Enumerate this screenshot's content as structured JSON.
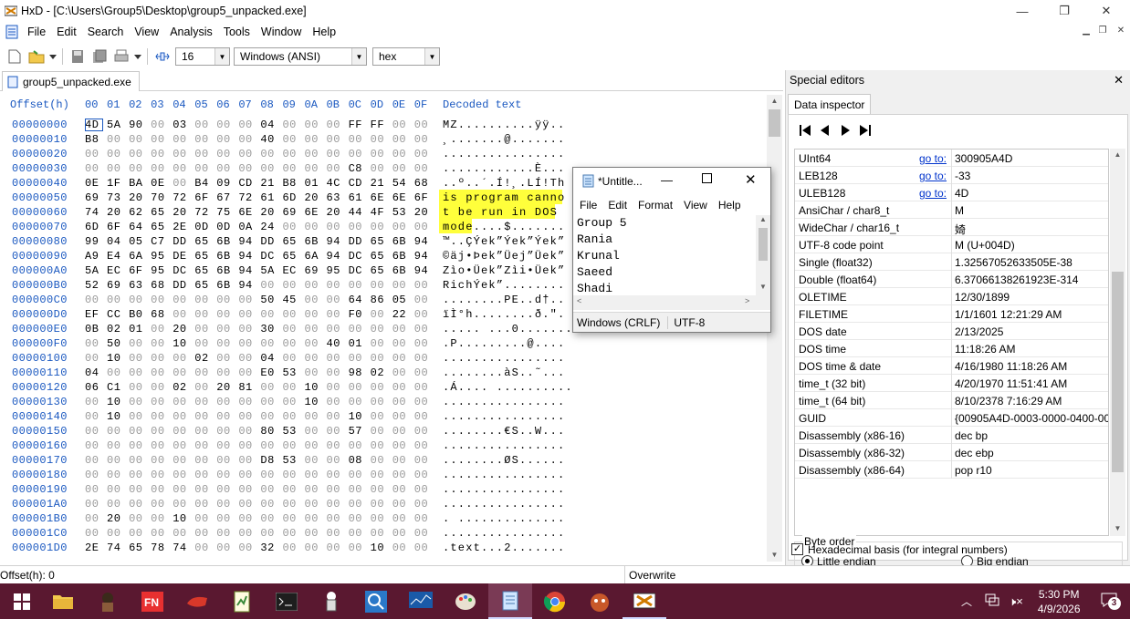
{
  "window": {
    "title": "HxD - [C:\\Users\\Group5\\Desktop\\group5_unpacked.exe]",
    "controls": {
      "minimize": "—",
      "maximize": "❐",
      "close": "✕"
    }
  },
  "menu": [
    "File",
    "Edit",
    "Search",
    "View",
    "Analysis",
    "Tools",
    "Window",
    "Help"
  ],
  "toolbar": {
    "bytes_per_row": "16",
    "charset": "Windows (ANSI)",
    "display_mode": "hex"
  },
  "tab": {
    "label": "group5_unpacked.exe"
  },
  "hex": {
    "offset_header": "Offset(h)",
    "column_headers": [
      "00",
      "01",
      "02",
      "03",
      "04",
      "05",
      "06",
      "07",
      "08",
      "09",
      "0A",
      "0B",
      "0C",
      "0D",
      "0E",
      "0F"
    ],
    "decoded_header": "Decoded text",
    "rows": [
      {
        "offset": "00000000",
        "bytes": [
          "4D",
          "5A",
          "90",
          "00",
          "03",
          "00",
          "00",
          "00",
          "04",
          "00",
          "00",
          "00",
          "FF",
          "FF",
          "00",
          "00"
        ],
        "decoded": "MZ..........ÿÿ.."
      },
      {
        "offset": "00000010",
        "bytes": [
          "B8",
          "00",
          "00",
          "00",
          "00",
          "00",
          "00",
          "00",
          "40",
          "00",
          "00",
          "00",
          "00",
          "00",
          "00",
          "00"
        ],
        "decoded": "¸.......@......."
      },
      {
        "offset": "00000020",
        "bytes": [
          "00",
          "00",
          "00",
          "00",
          "00",
          "00",
          "00",
          "00",
          "00",
          "00",
          "00",
          "00",
          "00",
          "00",
          "00",
          "00"
        ],
        "decoded": "................"
      },
      {
        "offset": "00000030",
        "bytes": [
          "00",
          "00",
          "00",
          "00",
          "00",
          "00",
          "00",
          "00",
          "00",
          "00",
          "00",
          "00",
          "C8",
          "00",
          "00",
          "00"
        ],
        "decoded": "............È..."
      },
      {
        "offset": "00000040",
        "bytes": [
          "0E",
          "1F",
          "BA",
          "0E",
          "00",
          "B4",
          "09",
          "CD",
          "21",
          "B8",
          "01",
          "4C",
          "CD",
          "21",
          "54",
          "68"
        ],
        "decoded": "..º..´.Í!¸.LÍ!Th"
      },
      {
        "offset": "00000050",
        "bytes": [
          "69",
          "73",
          "20",
          "70",
          "72",
          "6F",
          "67",
          "72",
          "61",
          "6D",
          "20",
          "63",
          "61",
          "6E",
          "6E",
          "6F"
        ],
        "decoded": "is program canno"
      },
      {
        "offset": "00000060",
        "bytes": [
          "74",
          "20",
          "62",
          "65",
          "20",
          "72",
          "75",
          "6E",
          "20",
          "69",
          "6E",
          "20",
          "44",
          "4F",
          "53",
          "20"
        ],
        "decoded": "t be run in DOS "
      },
      {
        "offset": "00000070",
        "bytes": [
          "6D",
          "6F",
          "64",
          "65",
          "2E",
          "0D",
          "0D",
          "0A",
          "24",
          "00",
          "00",
          "00",
          "00",
          "00",
          "00",
          "00"
        ],
        "decoded": "mode....$......."
      },
      {
        "offset": "00000080",
        "bytes": [
          "99",
          "04",
          "05",
          "C7",
          "DD",
          "65",
          "6B",
          "94",
          "DD",
          "65",
          "6B",
          "94",
          "DD",
          "65",
          "6B",
          "94"
        ],
        "decoded": "™..ÇÝek”Ýek”Ýek”"
      },
      {
        "offset": "00000090",
        "bytes": [
          "A9",
          "E4",
          "6A",
          "95",
          "DE",
          "65",
          "6B",
          "94",
          "DC",
          "65",
          "6A",
          "94",
          "DC",
          "65",
          "6B",
          "94"
        ],
        "decoded": "©äj•Þek”Üej”Üek”"
      },
      {
        "offset": "000000A0",
        "bytes": [
          "5A",
          "EC",
          "6F",
          "95",
          "DC",
          "65",
          "6B",
          "94",
          "5A",
          "EC",
          "69",
          "95",
          "DC",
          "65",
          "6B",
          "94"
        ],
        "decoded": "Zìo•Üek”Zìi•Üek”"
      },
      {
        "offset": "000000B0",
        "bytes": [
          "52",
          "69",
          "63",
          "68",
          "DD",
          "65",
          "6B",
          "94",
          "00",
          "00",
          "00",
          "00",
          "00",
          "00",
          "00",
          "00"
        ],
        "decoded": "RichÝek”........"
      },
      {
        "offset": "000000C0",
        "bytes": [
          "00",
          "00",
          "00",
          "00",
          "00",
          "00",
          "00",
          "00",
          "50",
          "45",
          "00",
          "00",
          "64",
          "86",
          "05",
          "00"
        ],
        "decoded": "........PE..d†.."
      },
      {
        "offset": "000000D0",
        "bytes": [
          "EF",
          "CC",
          "B0",
          "68",
          "00",
          "00",
          "00",
          "00",
          "00",
          "00",
          "00",
          "00",
          "F0",
          "00",
          "22",
          "00"
        ],
        "decoded": "ïÌ°h........ð.\"."
      },
      {
        "offset": "000000E0",
        "bytes": [
          "0B",
          "02",
          "01",
          "00",
          "20",
          "00",
          "00",
          "00",
          "30",
          "00",
          "00",
          "00",
          "00",
          "00",
          "00",
          "00"
        ],
        "decoded": "..... ...0......."
      },
      {
        "offset": "000000F0",
        "bytes": [
          "00",
          "50",
          "00",
          "00",
          "10",
          "00",
          "00",
          "00",
          "00",
          "00",
          "00",
          "40",
          "01",
          "00",
          "00",
          "00"
        ],
        "decoded": ".P.........@...."
      },
      {
        "offset": "00000100",
        "bytes": [
          "00",
          "10",
          "00",
          "00",
          "00",
          "02",
          "00",
          "00",
          "04",
          "00",
          "00",
          "00",
          "00",
          "00",
          "00",
          "00"
        ],
        "decoded": "................"
      },
      {
        "offset": "00000110",
        "bytes": [
          "04",
          "00",
          "00",
          "00",
          "00",
          "00",
          "00",
          "00",
          "E0",
          "53",
          "00",
          "00",
          "98",
          "02",
          "00",
          "00"
        ],
        "decoded": "........àS..˜..."
      },
      {
        "offset": "00000120",
        "bytes": [
          "06",
          "C1",
          "00",
          "00",
          "02",
          "00",
          "20",
          "81",
          "00",
          "00",
          "10",
          "00",
          "00",
          "00",
          "00",
          "00"
        ],
        "decoded": ".Á.... .........."
      },
      {
        "offset": "00000130",
        "bytes": [
          "00",
          "10",
          "00",
          "00",
          "00",
          "00",
          "00",
          "00",
          "00",
          "00",
          "10",
          "00",
          "00",
          "00",
          "00",
          "00"
        ],
        "decoded": "................"
      },
      {
        "offset": "00000140",
        "bytes": [
          "00",
          "10",
          "00",
          "00",
          "00",
          "00",
          "00",
          "00",
          "00",
          "00",
          "00",
          "00",
          "10",
          "00",
          "00",
          "00"
        ],
        "decoded": "................"
      },
      {
        "offset": "00000150",
        "bytes": [
          "00",
          "00",
          "00",
          "00",
          "00",
          "00",
          "00",
          "00",
          "80",
          "53",
          "00",
          "00",
          "57",
          "00",
          "00",
          "00"
        ],
        "decoded": "........€S..W..."
      },
      {
        "offset": "00000160",
        "bytes": [
          "00",
          "00",
          "00",
          "00",
          "00",
          "00",
          "00",
          "00",
          "00",
          "00",
          "00",
          "00",
          "00",
          "00",
          "00",
          "00"
        ],
        "decoded": "................"
      },
      {
        "offset": "00000170",
        "bytes": [
          "00",
          "00",
          "00",
          "00",
          "00",
          "00",
          "00",
          "00",
          "D8",
          "53",
          "00",
          "00",
          "08",
          "00",
          "00",
          "00"
        ],
        "decoded": "........ØS......"
      },
      {
        "offset": "00000180",
        "bytes": [
          "00",
          "00",
          "00",
          "00",
          "00",
          "00",
          "00",
          "00",
          "00",
          "00",
          "00",
          "00",
          "00",
          "00",
          "00",
          "00"
        ],
        "decoded": "................"
      },
      {
        "offset": "00000190",
        "bytes": [
          "00",
          "00",
          "00",
          "00",
          "00",
          "00",
          "00",
          "00",
          "00",
          "00",
          "00",
          "00",
          "00",
          "00",
          "00",
          "00"
        ],
        "decoded": "................"
      },
      {
        "offset": "000001A0",
        "bytes": [
          "00",
          "00",
          "00",
          "00",
          "00",
          "00",
          "00",
          "00",
          "00",
          "00",
          "00",
          "00",
          "00",
          "00",
          "00",
          "00"
        ],
        "decoded": "................"
      },
      {
        "offset": "000001B0",
        "bytes": [
          "00",
          "20",
          "00",
          "00",
          "10",
          "00",
          "00",
          "00",
          "00",
          "00",
          "00",
          "00",
          "00",
          "00",
          "00",
          "00"
        ],
        "decoded": ". .............."
      },
      {
        "offset": "000001C0",
        "bytes": [
          "00",
          "00",
          "00",
          "00",
          "00",
          "00",
          "00",
          "00",
          "00",
          "00",
          "00",
          "00",
          "00",
          "00",
          "00",
          "00"
        ],
        "decoded": "................"
      },
      {
        "offset": "000001D0",
        "bytes": [
          "2E",
          "74",
          "65",
          "78",
          "74",
          "00",
          "00",
          "00",
          "32",
          "00",
          "00",
          "00",
          "00",
          "10",
          "00",
          "00"
        ],
        "decoded": ".text...2......."
      }
    ]
  },
  "status": {
    "offset": "Offset(h): 0",
    "mode": "Overwrite"
  },
  "special_editors": {
    "title": "Special editors",
    "close": "✕",
    "tab": "Data inspector",
    "goto_label": "go to:",
    "rows": [
      {
        "label": "UInt64",
        "goto": true,
        "value": "300905A4D"
      },
      {
        "label": "LEB128",
        "goto": true,
        "value": "-33"
      },
      {
        "label": "ULEB128",
        "goto": true,
        "value": "4D"
      },
      {
        "label": "AnsiChar / char8_t",
        "goto": false,
        "value": "M"
      },
      {
        "label": "WideChar / char16_t",
        "goto": false,
        "value": "婍"
      },
      {
        "label": "UTF-8 code point",
        "goto": false,
        "value": "M (U+004D)"
      },
      {
        "label": "Single (float32)",
        "goto": false,
        "value": "1.32567052633505E-38"
      },
      {
        "label": "Double (float64)",
        "goto": false,
        "value": "6.37066138261923E-314"
      },
      {
        "label": "OLETIME",
        "goto": false,
        "value": "12/30/1899"
      },
      {
        "label": "FILETIME",
        "goto": false,
        "value": "1/1/1601 12:21:29 AM"
      },
      {
        "label": "DOS date",
        "goto": false,
        "value": "2/13/2025"
      },
      {
        "label": "DOS time",
        "goto": false,
        "value": "11:18:26 AM"
      },
      {
        "label": "DOS time & date",
        "goto": false,
        "value": "4/16/1980 11:18:26 AM"
      },
      {
        "label": "time_t (32 bit)",
        "goto": false,
        "value": "4/20/1970 11:51:41 AM"
      },
      {
        "label": "time_t (64 bit)",
        "goto": false,
        "value": "8/10/2378 7:16:29 AM"
      },
      {
        "label": "GUID",
        "goto": false,
        "value": "{00905A4D-0003-0000-0400-0000"
      },
      {
        "label": "Disassembly (x86-16)",
        "goto": false,
        "value": "dec bp"
      },
      {
        "label": "Disassembly (x86-32)",
        "goto": false,
        "value": "dec ebp"
      },
      {
        "label": "Disassembly (x86-64)",
        "goto": false,
        "value": "pop r10"
      }
    ],
    "byte_order": {
      "title": "Byte order",
      "little": "Little endian",
      "big": "Big endian",
      "selected": "little"
    },
    "hex_basis": "Hexadecimal basis (for integral numbers)"
  },
  "notepad": {
    "title": "*Untitle...",
    "menu": [
      "File",
      "Edit",
      "Format",
      "View",
      "Help"
    ],
    "lines": [
      "Group 5",
      "Rania",
      "Krunal",
      "Saeed",
      "Shadi"
    ],
    "eol": "Windows (CRLF)",
    "encoding": "UTF-8"
  },
  "taskbar": {
    "time": "5:30 PM",
    "date": "4/9/2026",
    "notifications": "3",
    "accent": "#5a1830"
  }
}
